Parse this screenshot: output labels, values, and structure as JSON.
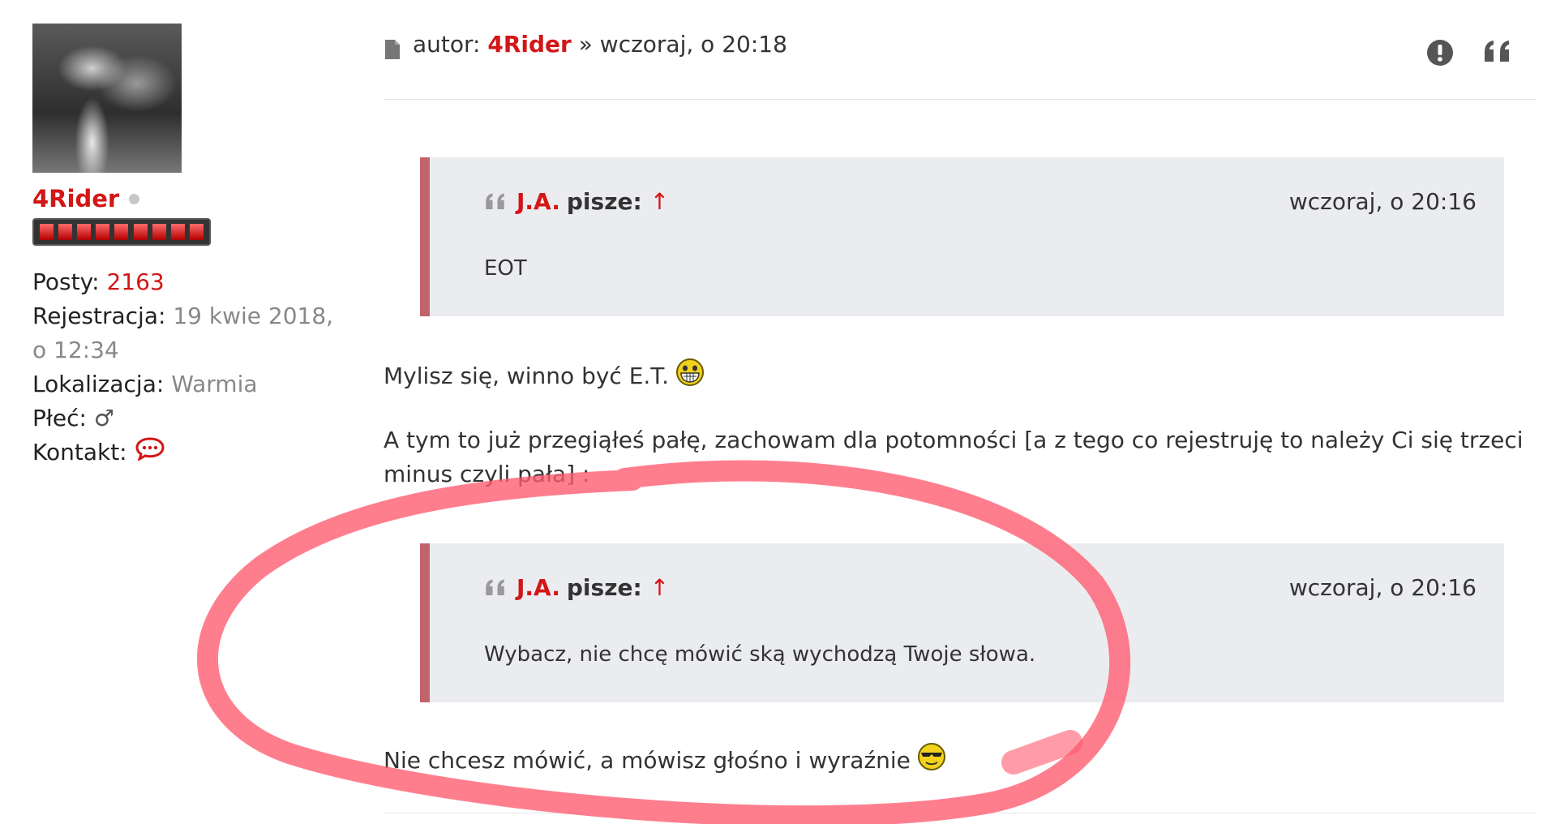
{
  "profile": {
    "username": "4Rider",
    "posts_label": "Posty:",
    "posts_value": "2163",
    "registration_label": "Rejestracja:",
    "registration_value": "19 kwie 2018, o 12:34",
    "location_label": "Lokalizacja:",
    "location_value": "Warmia",
    "gender_label": "Płeć:",
    "gender_value": "♂",
    "contact_label": "Kontakt:",
    "contact_icon": "chat-bubble-icon",
    "online_icon": "offline-dot-icon",
    "rank_icon": "rank-bar-icon"
  },
  "post": {
    "author_prefix": "autor:",
    "author": "4Rider",
    "date_text": "» wczoraj, o 20:18",
    "report_icon": "exclamation-circle-icon",
    "quote_icon": "quote-icon",
    "paragraph1": "Mylisz się, winno być E.T.",
    "paragraph2": "A tym to już przegiąłeś pałę, zachowam dla potomności [a z tego co rejestruję to należy Ci się trzeci minus czyli pała] :",
    "paragraph3": "Nie chcesz mówić, a mówisz głośno i wyraźnie",
    "quotes": [
      {
        "author": "J.A.",
        "label": "pisze:",
        "arrow": "↑",
        "date": "wczoraj, o 20:16",
        "text": "EOT"
      },
      {
        "author": "J.A.",
        "label": "pisze:",
        "arrow": "↑",
        "date": "wczoraj, o 20:16",
        "text": "Wybacz, nie chcę mówić ską wychodzą Twoje słowa."
      }
    ]
  },
  "colors": {
    "accent": "#d31616",
    "quote_bg": "#ebecf0",
    "quote_border": "#c0646a",
    "annotation": "#ff5a6e"
  }
}
